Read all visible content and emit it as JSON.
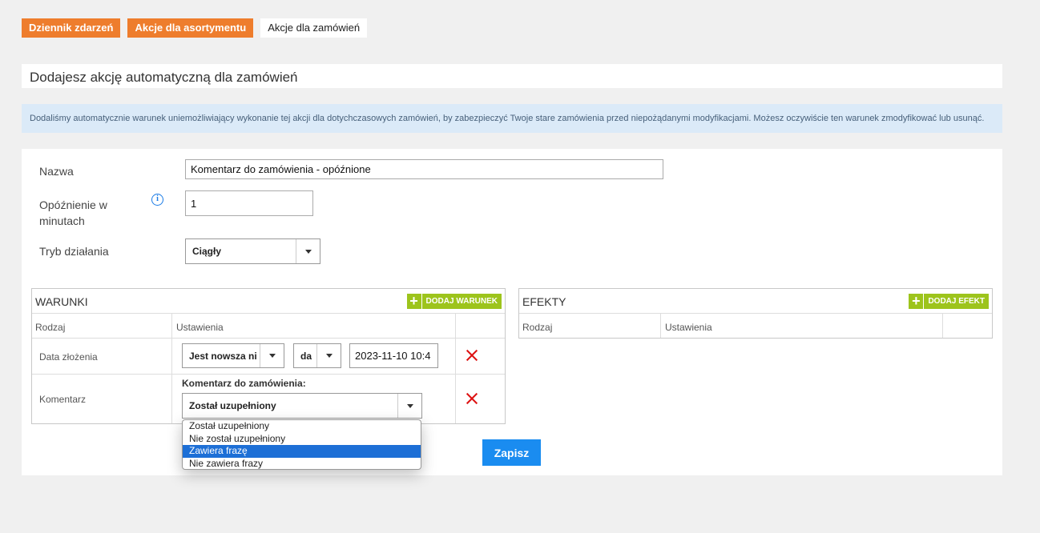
{
  "tabs": [
    {
      "label": "Dziennik zdarzeń"
    },
    {
      "label": "Akcje dla asortymentu"
    },
    {
      "label": "Akcje dla zamówień"
    }
  ],
  "page_title": "Dodajesz akcję automatyczną dla zamówień",
  "info_message": "Dodaliśmy automatycznie warunek uniemożliwiający wykonanie tej akcji dla dotychczasowych zamówień, by zabezpieczyć Twoje stare zamówienia przed niepożądanymi modyfikacjami. Możesz oczywiście ten warunek zmodyfikować lub usunąć.",
  "form": {
    "name_label": "Nazwa",
    "name_value": "Komentarz do zamówienia - opóźnione",
    "delay_label": "Opóźnienie w minutach",
    "delay_value": "1",
    "mode_label": "Tryb działania",
    "mode_value": "Ciągły"
  },
  "conditions": {
    "title": "WARUNKI",
    "add_label": "DODAJ WARUNEK",
    "col_type": "Rodzaj",
    "col_settings": "Ustawienia",
    "rows": [
      {
        "type": "Data złożenia",
        "operator": "Jest nowsza ni",
        "unit": "da",
        "date": "2023-11-10 10:4"
      },
      {
        "type": "Komentarz",
        "heading": "Komentarz do zamówienia:",
        "selected": "Został uzupełniony"
      }
    ]
  },
  "comment_options": [
    "Został uzupełniony",
    "Nie został uzupełniony",
    "Zawiera frazę",
    "Nie zawiera frazy"
  ],
  "effects": {
    "title": "EFEKTY",
    "add_label": "DODAJ EFEKT",
    "col_type": "Rodzaj",
    "col_settings": "Ustawienia"
  },
  "save_label": "Zapisz",
  "colors": {
    "tab_orange": "#ee7d2d",
    "add_green": "#9dc41c",
    "save_blue": "#1a8cf0",
    "info_bg": "#dbeaf8",
    "delete_red": "#dd1111"
  }
}
